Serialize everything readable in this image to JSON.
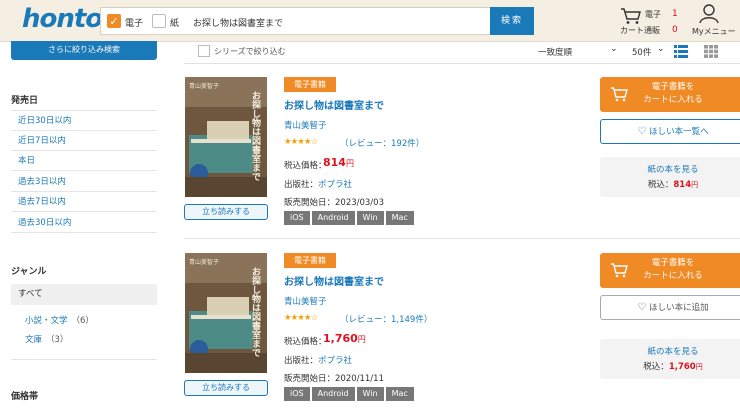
{
  "header": {
    "logo": "honto",
    "filters": [
      {
        "label": "電子",
        "checked": true
      },
      {
        "label": "紙",
        "checked": false
      }
    ],
    "search_value": "お探し物は図書室まで",
    "search_button": "検索",
    "cart": {
      "label_ebook": "電子",
      "label_store": "カート通販",
      "count_ebook": "1",
      "count_store": "0"
    },
    "my_menu": "Myメニュー",
    "accent": "#1a79b8",
    "orange": "#f08a24"
  },
  "sidebar": {
    "refine_button": "さらに絞り込み検索",
    "release_heading": "発売日",
    "release_links": [
      "近日30日以内",
      "近日7日以内",
      "本日",
      "過去3日以内",
      "過去7日以内",
      "過去30日以内"
    ],
    "genre_heading": "ジャンル",
    "genre_all": "すべて",
    "genres": [
      {
        "name": "小説・文学",
        "count": "（6）"
      },
      {
        "name": "文庫",
        "count": "（3）"
      }
    ],
    "price_heading": "価格帯"
  },
  "toolbar": {
    "series_filter": "シリーズで絞り込む",
    "sort": "一致度順",
    "per_page": "50件"
  },
  "products": [
    {
      "cover_author": "青山美智子",
      "cover_title": "お探し物は図書室まで",
      "read_button": "立ち読みする",
      "badge": "電子書籍",
      "title": "お探し物は図書室まで",
      "author": "青山美智子",
      "stars": "★★★★☆",
      "review": "（レビュー：192件）",
      "price_label": "税込価格：",
      "price": "814",
      "price_unit": "円",
      "publisher_label": "出版社：",
      "publisher": "ポプラ社",
      "release": "販売開始日：2023/03/03",
      "platforms": [
        "iOS",
        "Android",
        "Win",
        "Mac"
      ],
      "cart_line1": "電子書籍を",
      "cart_line2": "カートに入れる",
      "wish_button": "ほしい本一覧へ",
      "paper_link": "紙の本を見る",
      "paper_price_label": "税込：",
      "paper_price": "814",
      "paper_price_unit": "円"
    },
    {
      "cover_author": "青山美智子",
      "cover_title": "お探し物は図書室まで",
      "read_button": "立ち読みする",
      "badge": "電子書籍",
      "title": "お探し物は図書室まで",
      "author": "青山美智子",
      "stars": "★★★★☆",
      "review": "（レビュー：1,149件）",
      "price_label": "税込価格：",
      "price": "1,760",
      "price_unit": "円",
      "publisher_label": "出版社：",
      "publisher": "ポプラ社",
      "release": "販売開始日：2020/11/11",
      "platforms": [
        "iOS",
        "Android",
        "Win",
        "Mac"
      ],
      "cart_line1": "電子書籍を",
      "cart_line2": "カートに入れる",
      "wish_button": "ほしい本に追加",
      "paper_link": "紙の本を見る",
      "paper_price_label": "税込：",
      "paper_price": "1,760",
      "paper_price_unit": "円"
    }
  ]
}
